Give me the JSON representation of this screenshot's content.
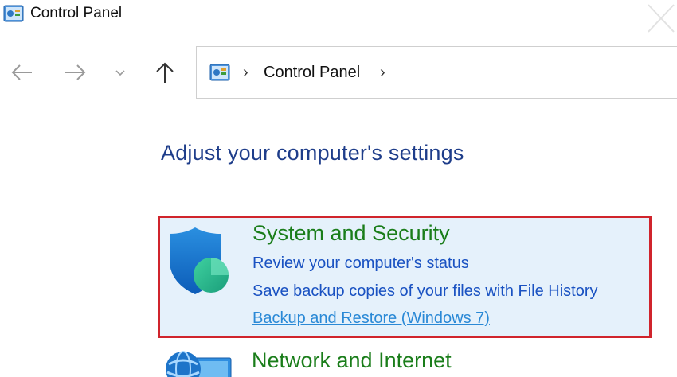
{
  "window": {
    "title": "Control Panel"
  },
  "navigation": {
    "back_icon": "arrow-left-icon",
    "forward_icon": "arrow-right-icon",
    "recent_icon": "chevron-down-icon",
    "up_icon": "arrow-up-icon"
  },
  "address_bar": {
    "separator": "›",
    "breadcrumb": "Control Panel",
    "trailing_separator": "›"
  },
  "main": {
    "heading": "Adjust your computer's settings",
    "categories": [
      {
        "title": "System and Security",
        "icon": "shield-icon",
        "highlighted": true,
        "links": [
          "Review your computer's status",
          "Save backup copies of your files with File History",
          "Backup and Restore (Windows 7)"
        ]
      },
      {
        "title": "Network and Internet",
        "icon": "globe-network-icon"
      }
    ]
  },
  "colors": {
    "heading": "#1e3d8a",
    "category_title": "#1a7d1a",
    "link": "#1a52c2",
    "highlight_background": "#e5f1fb",
    "highlight_border": "#d0242c"
  }
}
